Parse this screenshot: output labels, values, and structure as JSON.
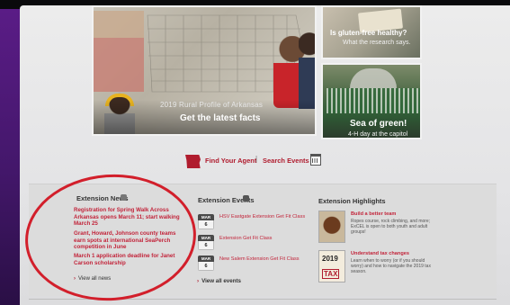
{
  "hero": {
    "main_subtitle": "2019 Rural Profile of Arkansas",
    "main_title": "Get the latest facts"
  },
  "side_cards": [
    {
      "title": "Is gluten-free healthy?",
      "subtitle": "What the research says."
    },
    {
      "title": "Sea of green!",
      "subtitle": "4-H day at the capitol"
    }
  ],
  "agent_bar": {
    "find_agent": "Find Your Agent",
    "separator": "|",
    "search_events": "Search Events"
  },
  "news": {
    "title": "Extension News",
    "items": [
      "Registration for Spring Walk Across Arkansas opens March 11; start walking March 25",
      "Grant, Howard, Johnson county teams earn spots at international SeaPerch competition in June",
      "March 1 application deadline for Janet Carson scholarship"
    ],
    "view_all": "View all news",
    "arrow": "›"
  },
  "events": {
    "title": "Extension Events",
    "items": [
      {
        "month": "MAR",
        "day": "6",
        "label": "HSV Eastgate Extension Get Fit Class"
      },
      {
        "month": "MAR",
        "day": "6",
        "label": "Extension Get Fit Class"
      },
      {
        "month": "MAR",
        "day": "6",
        "label": "New Salem Extension Get Fit Class"
      }
    ],
    "view_all": "View all events",
    "arrow": "›"
  },
  "highlights": {
    "title": "Extension Highlights",
    "items": [
      {
        "heading": "Build a better team",
        "body": "Ropes course, rock climbing, and more; ExCEL is open to both youth and adult groups!"
      },
      {
        "heading": "Understand tax changes",
        "body": "Learn when to worry (or if you should worry) and how to navigate the 2019 tax season."
      }
    ],
    "thumb2_year": "2019",
    "thumb2_text": "TAX"
  },
  "colors": {
    "accent_red": "#b01c2e",
    "link_red": "#c2243a",
    "callout_red": "#d21f2b",
    "bezel_purple": "#5a1c86"
  }
}
